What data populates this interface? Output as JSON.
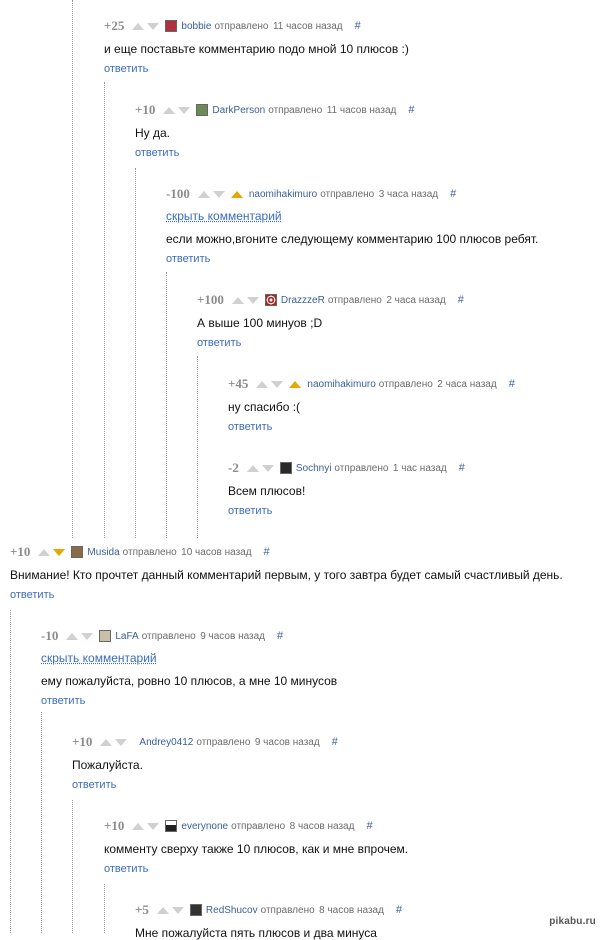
{
  "reply_label": "ответить",
  "hide_label": "скрыть комментарий",
  "sent_label": "отправлено",
  "hash": "#",
  "colors": {
    "link": "#3a6cbf",
    "vote_active": "#e6a700",
    "vote_idle": "#d0d0d0"
  },
  "comments": [
    {
      "rating": "+25",
      "user": "bobbie",
      "time": "11 часов назад",
      "text": "и еще поставьте комментарию подо мной 10 плюсов :)"
    },
    {
      "rating": "+10",
      "user": "DarkPerson",
      "time": "11 часов назад",
      "text": "Ну да."
    },
    {
      "rating": "-100",
      "user": "naomihakimuro",
      "time": "3 часа назад",
      "text": "если можно,вгоните следующему комментарию 100 плюсов ребят.",
      "hidden_link": true,
      "vote": "up"
    },
    {
      "rating": "+100",
      "user": "DrazzzeR",
      "time": "2 часа назад",
      "text": "А выше 100 минуов ;D"
    },
    {
      "rating": "+45",
      "user": "naomihakimuro",
      "time": "2 часа назад",
      "text": "ну спасибо :(",
      "vote": "up"
    },
    {
      "rating": "-2",
      "user": "Sochnyi",
      "time": "1 час назад",
      "text": "Всем плюсов!"
    },
    {
      "rating": "+10",
      "user": "Musida",
      "time": "10 часов назад",
      "text": "Внимание! Кто прочтет данный комментарий первым, у того завтра будет самый счастливый день.",
      "vote": "down"
    },
    {
      "rating": "-10",
      "user": "LaFA",
      "time": "9 часов назад",
      "text": "ему пожалуйста, ровно 10 плюсов, а мне 10 минусов",
      "hidden_link": true
    },
    {
      "rating": "+10",
      "user": "Andrey0412",
      "time": "9 часов назад",
      "text": "Пожалуйста."
    },
    {
      "rating": "+10",
      "user": "everynone",
      "time": "8 часов назад",
      "text": "комменту сверху также 10 плюсов, как и мне впрочем."
    },
    {
      "rating": "+5",
      "user": "RedShucov",
      "time": "8 часов назад",
      "text": "Мне пожалуйста пять плюсов и два минуса"
    }
  ],
  "watermark": "pikabu.ru"
}
